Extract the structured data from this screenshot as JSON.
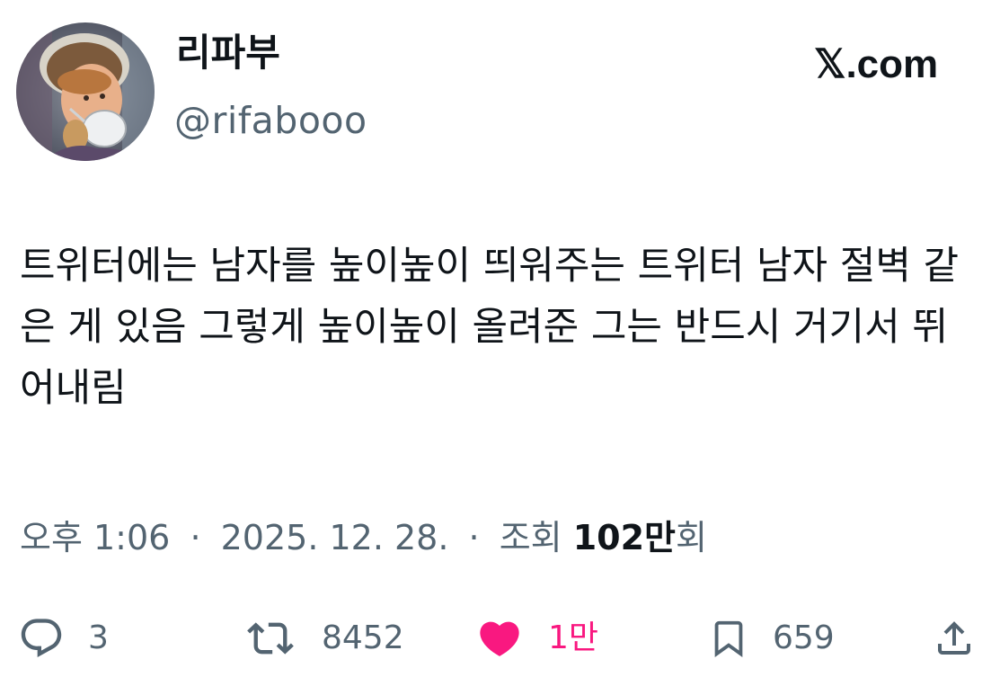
{
  "author": {
    "display_name": "리파부",
    "handle": "@rifabooo",
    "avatar_icon": "profile-avatar-painting"
  },
  "brand": {
    "text": "𝕏.com"
  },
  "tweet": {
    "text": "트위터에는 남자를 높이높이 띄워주는 트위터 남자 절벽 같은 게 있음 그렇게 높이높이 올려준 그는 반드시 거기서 뛰어내림"
  },
  "meta": {
    "time": "오후 1:06",
    "separator1": "·",
    "date": "2025. 12. 28.",
    "separator2": "·",
    "views_label": "조회",
    "views_count": "102만",
    "views_suffix": "회"
  },
  "actions": {
    "reply": {
      "icon": "reply-icon",
      "count": "3"
    },
    "retweet": {
      "icon": "retweet-icon",
      "count": "8452"
    },
    "like": {
      "icon": "heart-icon",
      "count": "1만",
      "liked": true,
      "color": "#f91880"
    },
    "bookmark": {
      "icon": "bookmark-icon",
      "count": "659"
    },
    "share": {
      "icon": "share-icon"
    }
  },
  "colors": {
    "text_primary": "#0f1419",
    "text_secondary": "#536471",
    "like_active": "#f91880"
  }
}
